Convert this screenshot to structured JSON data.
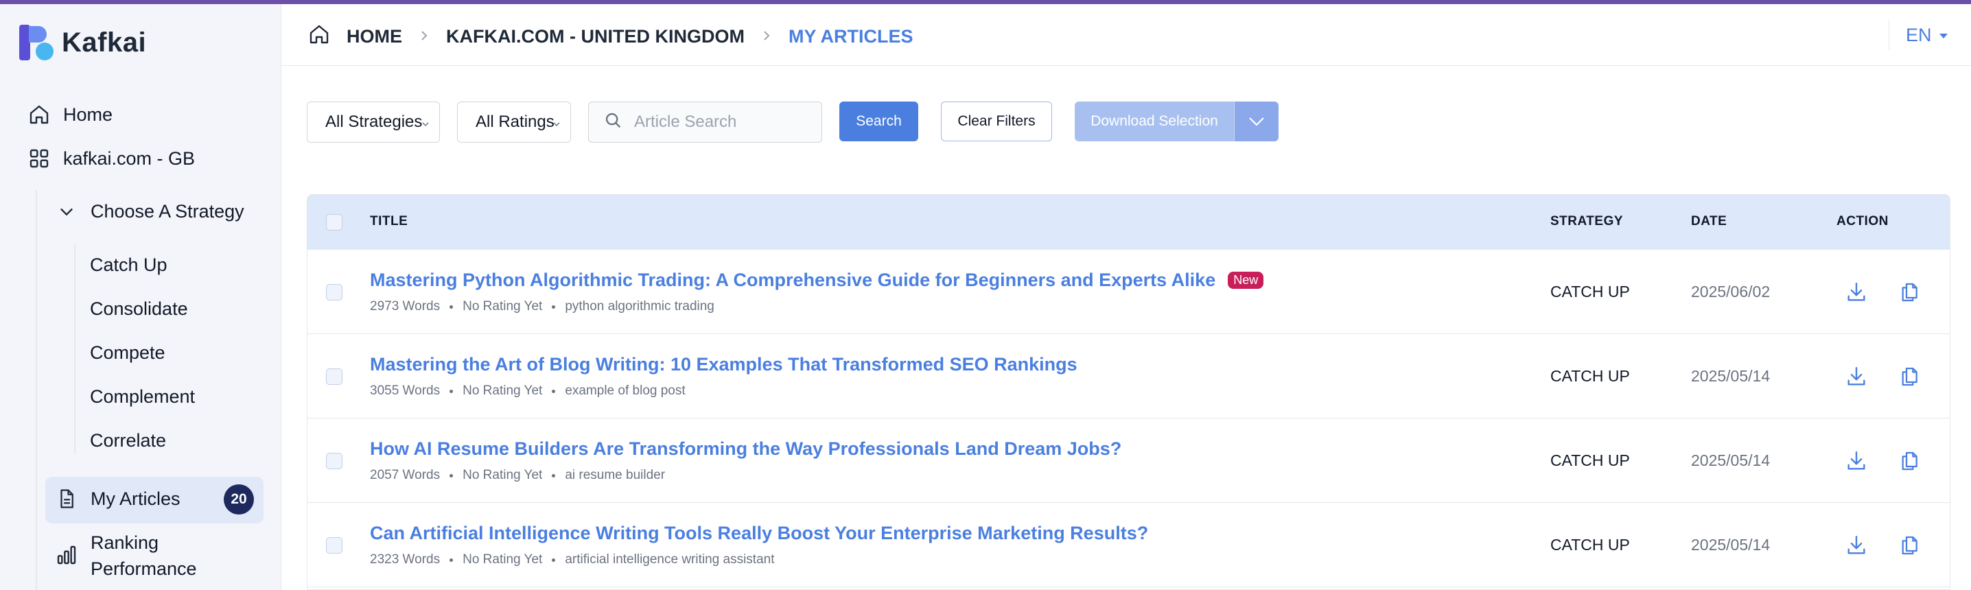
{
  "app": {
    "name": "Kafkai",
    "accent": "#4a7fe0",
    "brand_dark": "#1e2a5e"
  },
  "sidebar": {
    "home": "Home",
    "site": "kafkai.com - GB",
    "strategy_group": "Choose A Strategy",
    "strategies": [
      "Catch Up",
      "Consolidate",
      "Compete",
      "Complement",
      "Correlate"
    ],
    "my_articles": "My Articles",
    "my_articles_count": "20",
    "ranking_line1": "Ranking",
    "ranking_line2": "Performance"
  },
  "header": {
    "breadcrumbs": [
      "HOME",
      "KAFKAI.COM - UNITED KINGDOM",
      "MY ARTICLES"
    ],
    "language": "EN"
  },
  "filters": {
    "strategy_select": "All Strategies",
    "rating_select": "All Ratings",
    "search_placeholder": "Article Search",
    "search_button": "Search",
    "clear_button": "Clear Filters",
    "download_button": "Download Selection"
  },
  "table": {
    "columns": {
      "title": "TITLE",
      "strategy": "STRATEGY",
      "date": "DATE",
      "action": "ACTION"
    },
    "rows": [
      {
        "title": "Mastering Python Algorithmic Trading: A Comprehensive Guide for Beginners and Experts Alike",
        "badge": "New",
        "words": "2973 Words",
        "rating": "No Rating Yet",
        "keyword": "python algorithmic trading",
        "strategy": "CATCH UP",
        "date": "2025/06/02"
      },
      {
        "title": "Mastering the Art of Blog Writing: 10 Examples That Transformed SEO Rankings",
        "badge": "",
        "words": "3055 Words",
        "rating": "No Rating Yet",
        "keyword": "example of blog post",
        "strategy": "CATCH UP",
        "date": "2025/05/14"
      },
      {
        "title": "How AI Resume Builders Are Transforming the Way Professionals Land Dream Jobs?",
        "badge": "",
        "words": "2057 Words",
        "rating": "No Rating Yet",
        "keyword": "ai resume builder",
        "strategy": "CATCH UP",
        "date": "2025/05/14"
      },
      {
        "title": "Can Artificial Intelligence Writing Tools Really Boost Your Enterprise Marketing Results?",
        "badge": "",
        "words": "2323 Words",
        "rating": "No Rating Yet",
        "keyword": "artificial intelligence writing assistant",
        "strategy": "CATCH UP",
        "date": "2025/05/14"
      }
    ]
  }
}
